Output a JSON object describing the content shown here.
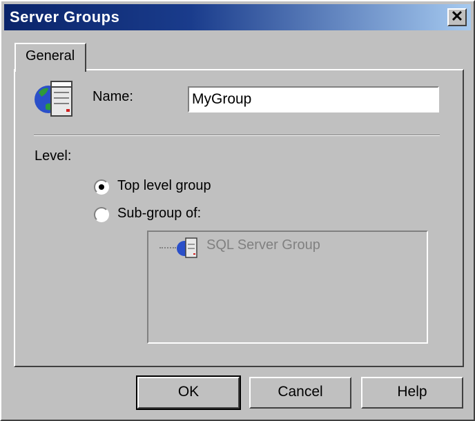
{
  "window": {
    "title": "Server Groups",
    "close_symbol": "✕"
  },
  "tabs": [
    {
      "label": "General",
      "active": true
    }
  ],
  "form": {
    "name_label": "Name:",
    "name_value": "MyGroup",
    "level_label": "Level:",
    "options": [
      {
        "label": "Top level group",
        "selected": true
      },
      {
        "label": "Sub-group of:",
        "selected": false
      }
    ]
  },
  "tree": {
    "items": [
      {
        "label": "SQL Server Group",
        "icon": "server-icon",
        "enabled": false
      }
    ]
  },
  "buttons": {
    "ok": "OK",
    "cancel": "Cancel",
    "help": "Help"
  },
  "icons": {
    "header": "server-globe-icon"
  },
  "colors": {
    "titlebar_start": "#0a246a",
    "titlebar_end": "#a6caf0",
    "face": "#c0c0c0"
  }
}
